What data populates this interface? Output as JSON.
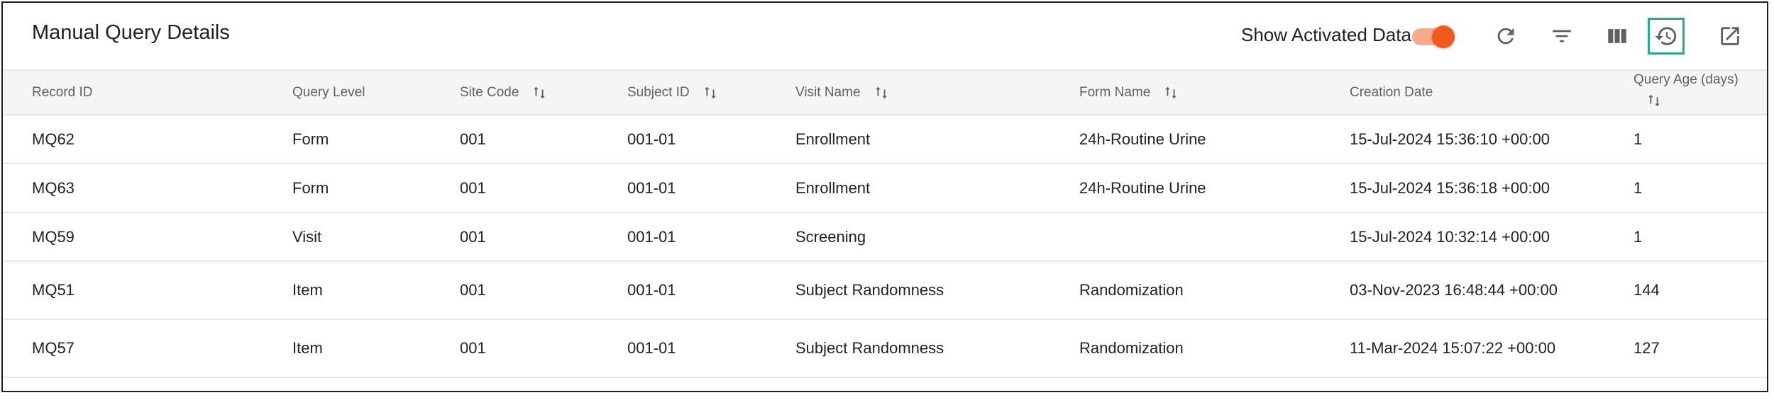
{
  "header": {
    "title": "Manual Query Details",
    "toggle_label": "Show Activated Data",
    "toggle_on": true,
    "accent_color": "#f25a1c",
    "selected_tool_color": "#27a99a",
    "tools": [
      "refresh-icon",
      "filter-icon",
      "columns-icon",
      "history-icon",
      "open-external-icon"
    ]
  },
  "table": {
    "columns": [
      "Record ID",
      "Query Level",
      "Site Code",
      "Subject ID",
      "Visit Name",
      "Form Name",
      "Creation Date",
      "Query Age (days)"
    ],
    "rows": [
      [
        "MQ62",
        "Form",
        "001",
        "001-01",
        "Enrollment",
        "24h-Routine Urine",
        "15-Jul-2024 15:36:10 +00:00",
        "1"
      ],
      [
        "MQ63",
        "Form",
        "001",
        "001-01",
        "Enrollment",
        "24h-Routine Urine",
        "15-Jul-2024 15:36:18 +00:00",
        "1"
      ],
      [
        "MQ59",
        "Visit",
        "001",
        "001-01",
        "Screening",
        "",
        "15-Jul-2024 10:32:14 +00:00",
        "1"
      ],
      [
        "MQ51",
        "Item",
        "001",
        "001-01",
        "Subject Randomness",
        "Randomization",
        "03-Nov-2023 16:48:44 +00:00",
        "144"
      ],
      [
        "MQ57",
        "Item",
        "001",
        "001-01",
        "Subject Randomness",
        "Randomization",
        "11-Mar-2024 15:07:22 +00:00",
        "127"
      ]
    ]
  }
}
